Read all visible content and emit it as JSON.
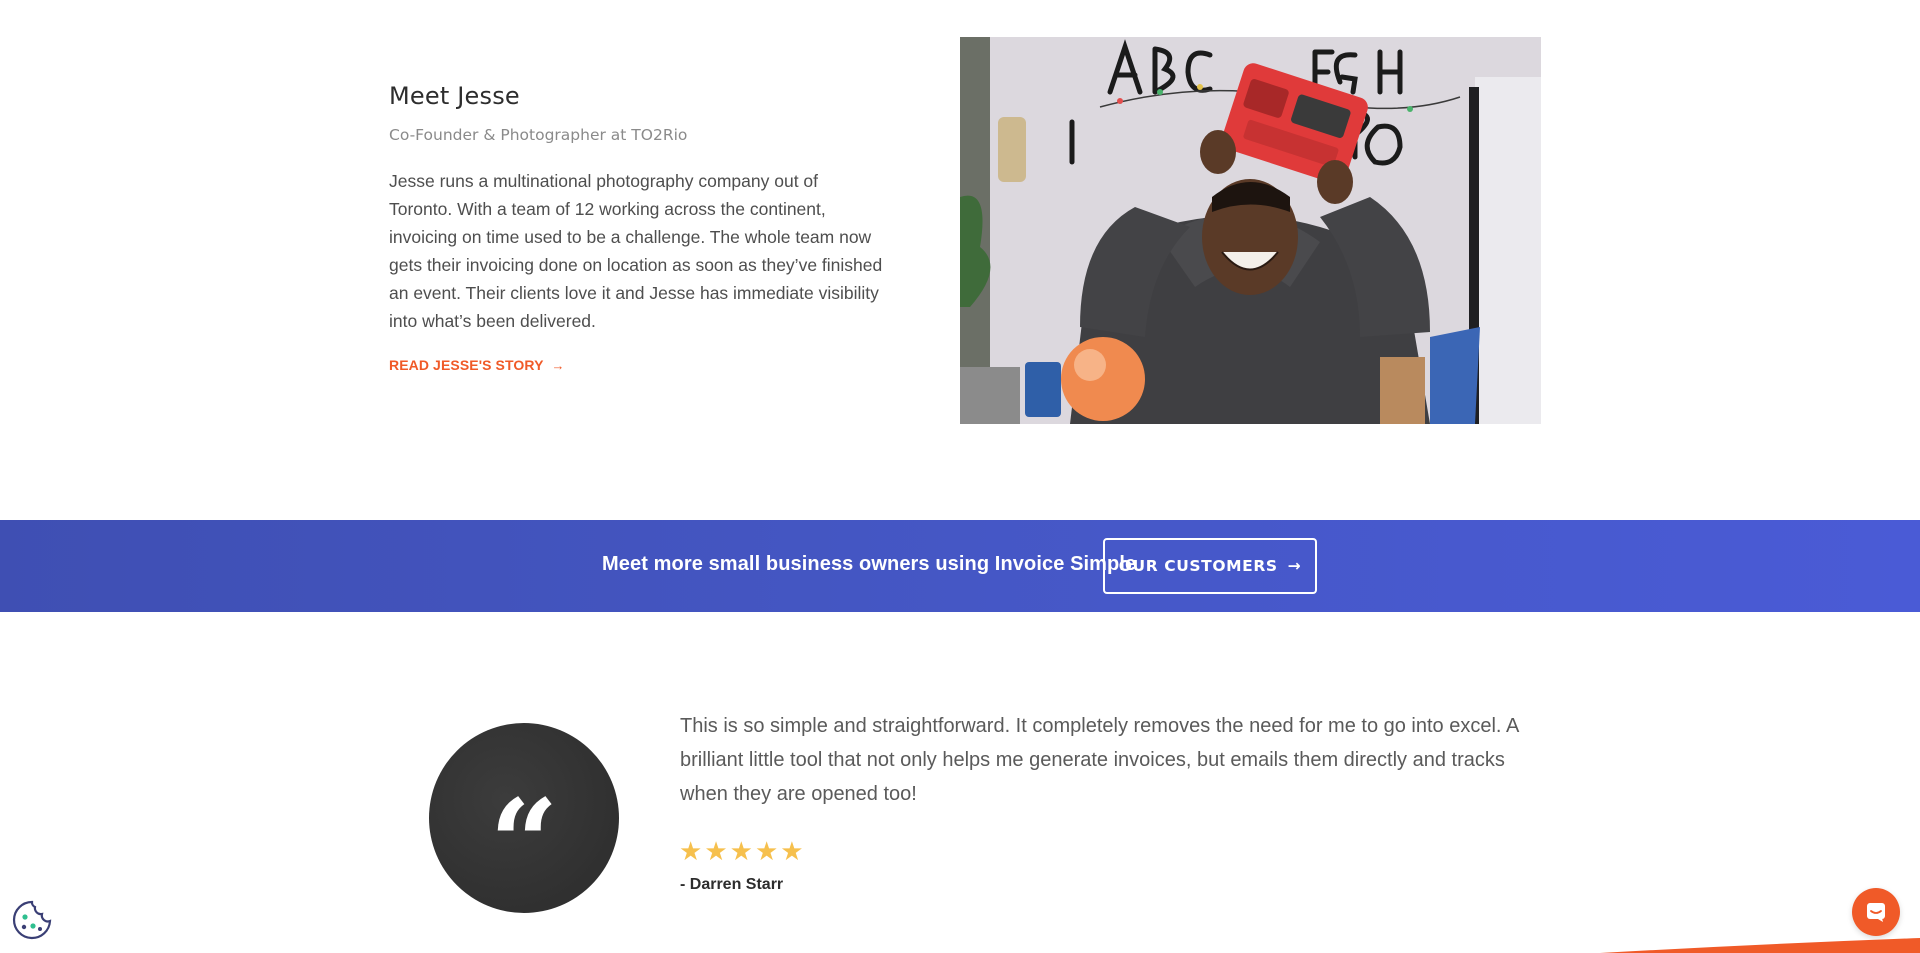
{
  "story": {
    "title": "Meet Jesse",
    "subtitle": "Co-Founder & Photographer at TO2Rio",
    "body": "Jesse runs a multinational photography company out of Toronto. With a team of 12 working across the continent, invoicing on time used to be a challenge. The whole team now gets their invoicing done on location as soon as they’ve finished an event. Their clients love it and Jesse has immediate visibility into what’s been delivered.",
    "link_label": "READ JESSE'S STORY",
    "link_arrow": "→"
  },
  "banner": {
    "text": "Meet more small business owners using Invoice Simple",
    "button_label": "OUR CUSTOMERS",
    "button_arrow": "→"
  },
  "testimonial": {
    "quote_mark": "“",
    "text": "This is so simple and straightforward. It completely removes the need for me to go into excel. A brilliant little tool that not only helps me generate invoices, but emails them directly and tracks when they are opened too!",
    "rating": 5,
    "rating_max": 5,
    "author": "- Darren Starr"
  },
  "colors": {
    "accent": "#f05a28",
    "banner": "#4557c5",
    "star": "#f6c04d",
    "quote_circle": "#333333"
  },
  "icons": {
    "cookie": "cookie-icon",
    "chat": "chat-icon"
  }
}
